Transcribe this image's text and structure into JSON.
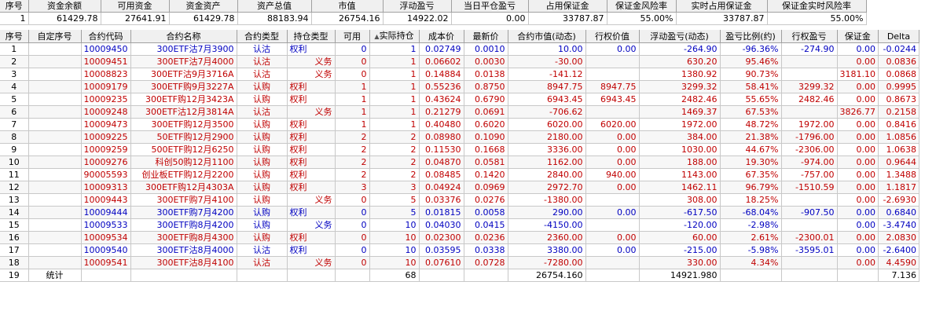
{
  "summary": {
    "headers": [
      "序号",
      "资金余额",
      "可用资金",
      "资金资产",
      "资产总值",
      "市值",
      "浮动盈亏",
      "当日平仓盈亏",
      "占用保证金",
      "保证金风险率",
      "实时占用保证金",
      "保证金实时风险率"
    ],
    "row": [
      "1",
      "61429.78",
      "27641.91",
      "61429.78",
      "88183.94",
      "26754.16",
      "14922.02",
      "0.00",
      "33787.87",
      "55.00%",
      "33787.87",
      "55.00%"
    ]
  },
  "positions": {
    "headers": [
      "序号",
      "自定序号",
      "合约代码",
      "合约名称",
      "合约类型",
      "持仓类型",
      "可用",
      "实际持仓",
      "成本价",
      "最新价",
      "合约市值(动态)",
      "行权价值",
      "浮动盈亏(动态)",
      "盈亏比例(约)",
      "行权盈亏",
      "保证金",
      "Delta"
    ],
    "sort_indicator": "▲",
    "colors": {
      "red": "#c00000",
      "blue": "#0000c0",
      "black": "#000000"
    },
    "rows": [
      {
        "idx": "1",
        "custom": "",
        "code": "10009450",
        "name": "300ETF沽7月3900",
        "ctype": "认沽",
        "ptype": "权利",
        "avail": "0",
        "qty": "1",
        "cost": "0.02749",
        "last": "0.0010",
        "mv": "10.00",
        "exv": "0.00",
        "pnl": "-264.90",
        "ratio": "-96.36%",
        "expnl": "-274.90",
        "margin": "0.00",
        "delta": "-0.0244",
        "color": "blue"
      },
      {
        "idx": "2",
        "custom": "",
        "code": "10009451",
        "name": "300ETF沽7月4000",
        "ctype": "认沽",
        "ptype": "义务",
        "avail": "0",
        "qty": "1",
        "cost": "0.06602",
        "last": "0.0030",
        "mv": "-30.00",
        "exv": "",
        "pnl": "630.20",
        "ratio": "95.46%",
        "expnl": "",
        "margin": "0.00",
        "delta": "0.0836",
        "color": "red"
      },
      {
        "idx": "3",
        "custom": "",
        "code": "10008823",
        "name": "300ETF沽9月3716A",
        "ctype": "认沽",
        "ptype": "义务",
        "avail": "0",
        "qty": "1",
        "cost": "0.14884",
        "last": "0.0138",
        "mv": "-141.12",
        "exv": "",
        "pnl": "1380.92",
        "ratio": "90.73%",
        "expnl": "",
        "margin": "3181.10",
        "delta": "0.0868",
        "color": "red"
      },
      {
        "idx": "4",
        "custom": "",
        "code": "10009179",
        "name": "300ETF购9月3227A",
        "ctype": "认购",
        "ptype": "权利",
        "avail": "1",
        "qty": "1",
        "cost": "0.55236",
        "last": "0.8750",
        "mv": "8947.75",
        "exv": "8947.75",
        "pnl": "3299.32",
        "ratio": "58.41%",
        "expnl": "3299.32",
        "margin": "0.00",
        "delta": "0.9995",
        "color": "red"
      },
      {
        "idx": "5",
        "custom": "",
        "code": "10009235",
        "name": "300ETF购12月3423A",
        "ctype": "认购",
        "ptype": "权利",
        "avail": "1",
        "qty": "1",
        "cost": "0.43624",
        "last": "0.6790",
        "mv": "6943.45",
        "exv": "6943.45",
        "pnl": "2482.46",
        "ratio": "55.65%",
        "expnl": "2482.46",
        "margin": "0.00",
        "delta": "0.8673",
        "color": "red"
      },
      {
        "idx": "6",
        "custom": "",
        "code": "10009248",
        "name": "300ETF沽12月3814A",
        "ctype": "认沽",
        "ptype": "义务",
        "avail": "1",
        "qty": "1",
        "cost": "0.21279",
        "last": "0.0691",
        "mv": "-706.62",
        "exv": "",
        "pnl": "1469.37",
        "ratio": "67.53%",
        "expnl": "",
        "margin": "3826.77",
        "delta": "0.2158",
        "color": "red"
      },
      {
        "idx": "7",
        "custom": "",
        "code": "10009473",
        "name": "300ETF购12月3500",
        "ctype": "认购",
        "ptype": "权利",
        "avail": "1",
        "qty": "1",
        "cost": "0.40480",
        "last": "0.6020",
        "mv": "6020.00",
        "exv": "6020.00",
        "pnl": "1972.00",
        "ratio": "48.72%",
        "expnl": "1972.00",
        "margin": "0.00",
        "delta": "0.8416",
        "color": "red"
      },
      {
        "idx": "8",
        "custom": "",
        "code": "10009225",
        "name": "50ETF购12月2900",
        "ctype": "认购",
        "ptype": "权利",
        "avail": "2",
        "qty": "2",
        "cost": "0.08980",
        "last": "0.1090",
        "mv": "2180.00",
        "exv": "0.00",
        "pnl": "384.00",
        "ratio": "21.38%",
        "expnl": "-1796.00",
        "margin": "0.00",
        "delta": "1.0856",
        "color": "red"
      },
      {
        "idx": "9",
        "custom": "",
        "code": "10009259",
        "name": "500ETF购12月6250",
        "ctype": "认购",
        "ptype": "权利",
        "avail": "2",
        "qty": "2",
        "cost": "0.11530",
        "last": "0.1668",
        "mv": "3336.00",
        "exv": "0.00",
        "pnl": "1030.00",
        "ratio": "44.67%",
        "expnl": "-2306.00",
        "margin": "0.00",
        "delta": "1.0638",
        "color": "red"
      },
      {
        "idx": "10",
        "custom": "",
        "code": "10009276",
        "name": "科创50购12月1100",
        "ctype": "认购",
        "ptype": "权利",
        "avail": "2",
        "qty": "2",
        "cost": "0.04870",
        "last": "0.0581",
        "mv": "1162.00",
        "exv": "0.00",
        "pnl": "188.00",
        "ratio": "19.30%",
        "expnl": "-974.00",
        "margin": "0.00",
        "delta": "0.9644",
        "color": "red"
      },
      {
        "idx": "11",
        "custom": "",
        "code": "90005593",
        "name": "创业板ETF购12月2200",
        "ctype": "认购",
        "ptype": "权利",
        "avail": "2",
        "qty": "2",
        "cost": "0.08485",
        "last": "0.1420",
        "mv": "2840.00",
        "exv": "940.00",
        "pnl": "1143.00",
        "ratio": "67.35%",
        "expnl": "-757.00",
        "margin": "0.00",
        "delta": "1.3488",
        "color": "red"
      },
      {
        "idx": "12",
        "custom": "",
        "code": "10009313",
        "name": "300ETF购12月4303A",
        "ctype": "认购",
        "ptype": "权利",
        "avail": "3",
        "qty": "3",
        "cost": "0.04924",
        "last": "0.0969",
        "mv": "2972.70",
        "exv": "0.00",
        "pnl": "1462.11",
        "ratio": "96.79%",
        "expnl": "-1510.59",
        "margin": "0.00",
        "delta": "1.1817",
        "color": "red"
      },
      {
        "idx": "13",
        "custom": "",
        "code": "10009443",
        "name": "300ETF购7月4100",
        "ctype": "认购",
        "ptype": "义务",
        "avail": "0",
        "qty": "5",
        "cost": "0.03376",
        "last": "0.0276",
        "mv": "-1380.00",
        "exv": "",
        "pnl": "308.00",
        "ratio": "18.25%",
        "expnl": "",
        "margin": "0.00",
        "delta": "-2.6930",
        "color": "red"
      },
      {
        "idx": "14",
        "custom": "",
        "code": "10009444",
        "name": "300ETF购7月4200",
        "ctype": "认购",
        "ptype": "权利",
        "avail": "0",
        "qty": "5",
        "cost": "0.01815",
        "last": "0.0058",
        "mv": "290.00",
        "exv": "0.00",
        "pnl": "-617.50",
        "ratio": "-68.04%",
        "expnl": "-907.50",
        "margin": "0.00",
        "delta": "0.6840",
        "color": "blue"
      },
      {
        "idx": "15",
        "custom": "",
        "code": "10009533",
        "name": "300ETF购8月4200",
        "ctype": "认购",
        "ptype": "义务",
        "avail": "0",
        "qty": "10",
        "cost": "0.04030",
        "last": "0.0415",
        "mv": "-4150.00",
        "exv": "",
        "pnl": "-120.00",
        "ratio": "-2.98%",
        "expnl": "",
        "margin": "0.00",
        "delta": "-3.4740",
        "color": "blue"
      },
      {
        "idx": "16",
        "custom": "",
        "code": "10009534",
        "name": "300ETF购8月4300",
        "ctype": "认购",
        "ptype": "权利",
        "avail": "0",
        "qty": "10",
        "cost": "0.02300",
        "last": "0.0236",
        "mv": "2360.00",
        "exv": "0.00",
        "pnl": "60.00",
        "ratio": "2.61%",
        "expnl": "-2300.01",
        "margin": "0.00",
        "delta": "2.0830",
        "color": "red"
      },
      {
        "idx": "17",
        "custom": "",
        "code": "10009540",
        "name": "300ETF沽8月4000",
        "ctype": "认沽",
        "ptype": "权利",
        "avail": "0",
        "qty": "10",
        "cost": "0.03595",
        "last": "0.0338",
        "mv": "3380.00",
        "exv": "0.00",
        "pnl": "-215.00",
        "ratio": "-5.98%",
        "expnl": "-3595.01",
        "margin": "0.00",
        "delta": "-2.6400",
        "color": "blue"
      },
      {
        "idx": "18",
        "custom": "",
        "code": "10009541",
        "name": "300ETF沽8月4100",
        "ctype": "认沽",
        "ptype": "义务",
        "avail": "0",
        "qty": "10",
        "cost": "0.07610",
        "last": "0.0728",
        "mv": "-7280.00",
        "exv": "",
        "pnl": "330.00",
        "ratio": "4.34%",
        "expnl": "",
        "margin": "0.00",
        "delta": "4.4590",
        "color": "red"
      }
    ],
    "total": {
      "idx": "19",
      "label": "统计",
      "qty": "68",
      "mv": "26754.160",
      "pnl": "14921.980",
      "delta": "7.136"
    }
  }
}
